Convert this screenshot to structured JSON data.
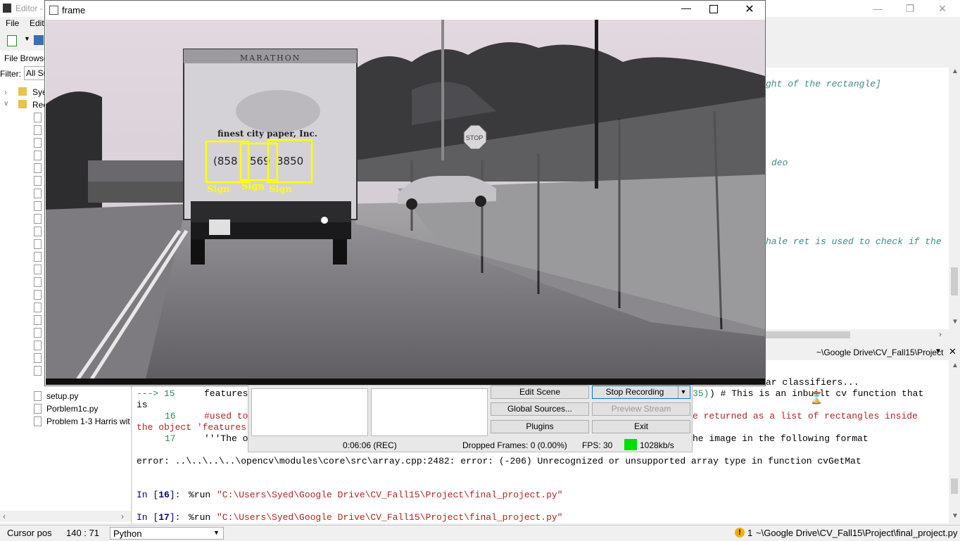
{
  "editor": {
    "title": "Editor -",
    "menu": [
      "File",
      "Edit"
    ],
    "file_browser_tab": "File Browser",
    "filter_label": "Filter:",
    "filter_value": "All Su",
    "tree": [
      {
        "label": "Sye",
        "type": "folder",
        "expanded": false
      },
      {
        "label": "Rec",
        "type": "folder",
        "expanded": true
      }
    ],
    "files": [
      "setup.py",
      "Porblem1c.py",
      "Problem 1-3 Harris wit"
    ],
    "code_fragments": [
      "ght of the rectangle]",
      "deo",
      "hale ret is used to check if the"
    ],
    "console_path": "~\\Google Drive\\CV_Fall15\\Project"
  },
  "console": {
    "line_classifiers": "ar classifiers...",
    "line15_arrow": "---> 15",
    "line15_code": "features",
    "line15_tail_num": "35)",
    "line15_tail": ") # This is an inbuilt cv function that",
    "line15_wrap": "is",
    "line16_num": "16",
    "line16_code": "#used to",
    "line16_tail": "e returned as a list of rectangles inside",
    "line16_wrap": "the object 'features",
    "line17_num": "17",
    "line17_code": "'''The o",
    "line17_tail": "he image in the following format",
    "error": "error: ..\\..\\..\\..\\opencv\\modules\\core\\src\\array.cpp:2482: error: (-206) Unrecognized or unsupported array type in function cvGetMat",
    "prompt16_in": "In [",
    "prompt16_num": "16",
    "prompt16_close": "]: ",
    "prompt16_cmd": "%run ",
    "prompt16_path": "\"C:\\Users\\Syed\\Google Drive\\CV_Fall15\\Project\\final_project.py\"",
    "prompt17_num": "17",
    "prompt17_path": "\"C:\\Users\\Syed\\Google Drive\\CV_Fall15\\Project\\final_project.py\""
  },
  "statusbar": {
    "cursor_label": "Cursor pos",
    "cursor_value": "140 : 71",
    "language": "Python",
    "warning_count": "1",
    "file_path": "~\\Google Drive\\CV_Fall15\\Project\\final_project.py"
  },
  "frame_window": {
    "title": "frame",
    "truck_brand": "MARATHON",
    "truck_text": "finest city paper, Inc.",
    "phone_parts": [
      "(858",
      "569",
      "3850"
    ],
    "detection_label": "Sign",
    "stop_sign": "STOP",
    "box_color": "#ffff00"
  },
  "obs": {
    "edit_scene": "Edit Scene",
    "stop_recording": "Stop Recording",
    "global_sources": "Global Sources...",
    "preview_stream": "Preview Stream",
    "plugins": "Plugins",
    "exit": "Exit",
    "time": "0:06:06 (REC)",
    "dropped_frames": "Dropped Frames: 0 (0.00%)",
    "fps": "FPS: 30",
    "bitrate": "1028kb/s",
    "status_color": "#00e000"
  }
}
